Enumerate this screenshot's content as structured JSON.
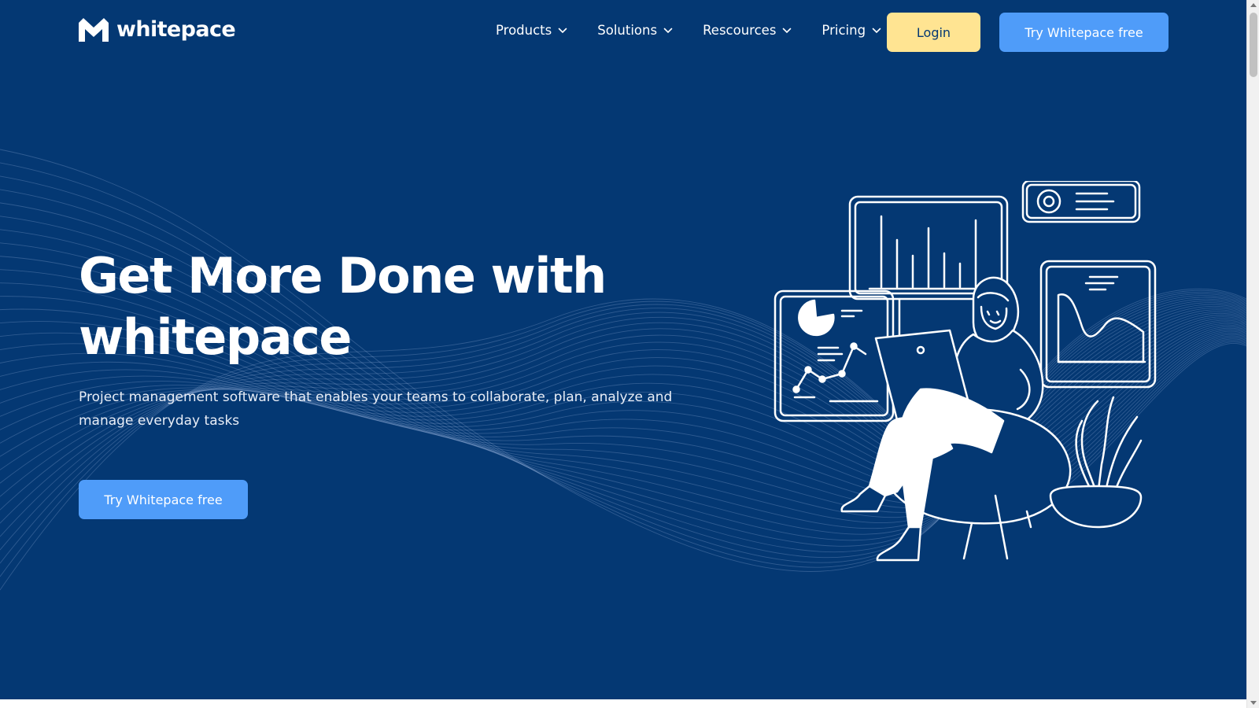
{
  "brand": {
    "name": "whitepace",
    "logo_icon": "whitepace-logo-icon"
  },
  "nav": {
    "items": [
      {
        "label": "Products",
        "icon": "chevron-down-icon"
      },
      {
        "label": "Solutions",
        "icon": "chevron-down-icon"
      },
      {
        "label": "Rescources",
        "icon": "chevron-down-icon"
      },
      {
        "label": "Pricing",
        "icon": "chevron-down-icon"
      }
    ],
    "login_label": "Login",
    "cta_label": "Try Whitepace free"
  },
  "hero": {
    "title_line1": "Get More Done with",
    "title_line2": "whitepace",
    "subtitle": "Project management software that enables your teams to collaborate, plan, analyze and manage everyday tasks",
    "cta_label": "Try Whitepace free",
    "illustration": "woman-with-laptop-dashboard-illustration"
  },
  "colors": {
    "background": "#043873",
    "login_button": "#ffe492",
    "primary_button": "#4f9cf9",
    "text": "#ffffff"
  }
}
